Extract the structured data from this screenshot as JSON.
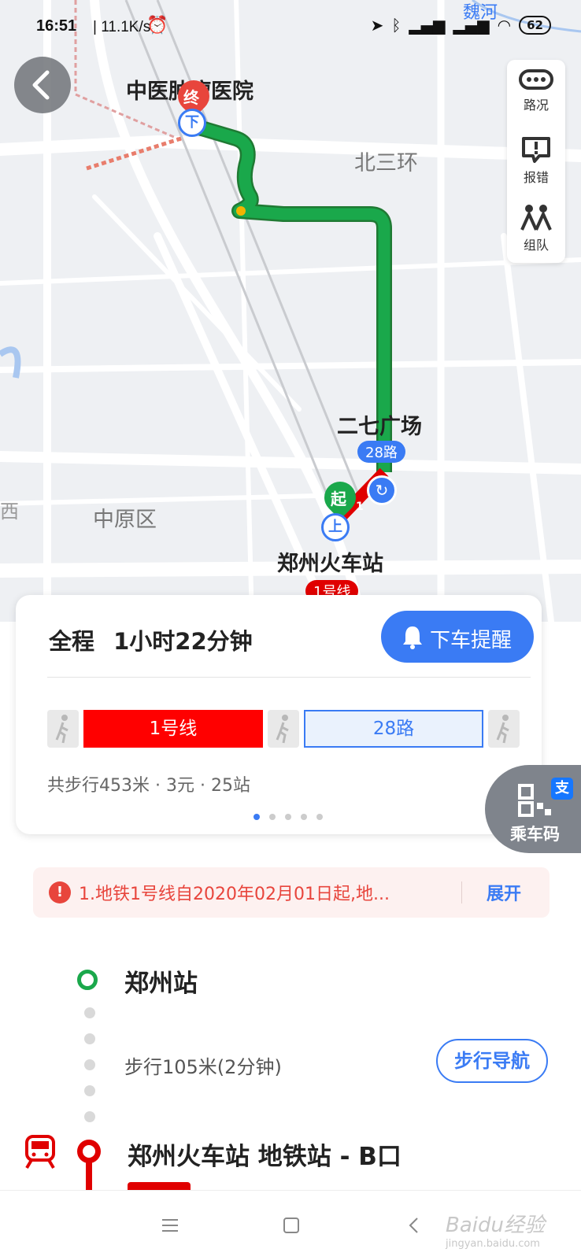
{
  "status_bar": {
    "time": "16:51",
    "network_speed": "| 11.1K/s",
    "battery": "62"
  },
  "map": {
    "labels": {
      "river": "魏河",
      "destination_name": "中医肿瘤医院",
      "ring_road": "北三环",
      "transfer_stop": "二七广场",
      "district": "中原区",
      "origin_station": "郑州火车站",
      "edge_fragment": "西"
    },
    "markers": {
      "end_badge": "终",
      "start_badge": "起",
      "alight": "下",
      "board": "上",
      "bus_route": "28路",
      "metro_line": "1号线",
      "metro_short": "1"
    }
  },
  "tools": [
    {
      "label": "路况",
      "icon": "traffic-icon"
    },
    {
      "label": "报错",
      "icon": "report-error-icon"
    },
    {
      "label": "组队",
      "icon": "team-icon"
    }
  ],
  "route_card": {
    "total_label": "全程",
    "total_time": "1小时22分钟",
    "remind_button": "下车提醒",
    "segments": [
      "1号线",
      "28路"
    ],
    "summary": "共步行453米 · 3元 · 25站",
    "page_index": 1,
    "page_count": 5
  },
  "ride_code": {
    "label": "乘车码",
    "badge": "支"
  },
  "notice": {
    "text": "1.地铁1号线自2020年02月01日起,地...",
    "expand": "展开"
  },
  "steps": {
    "start_station": "郑州站",
    "walk_info": "步行105米(2分钟)",
    "walk_nav_button": "步行导航",
    "metro_station": "郑州火车站 地铁站 - B口"
  },
  "watermark": {
    "brand": "Baidu经验",
    "url": "jingyan.baidu.com"
  },
  "colors": {
    "accent": "#3a7bf4",
    "metro": "#ff0000",
    "route_green": "#1aa84b",
    "alert": "#e8453c"
  }
}
